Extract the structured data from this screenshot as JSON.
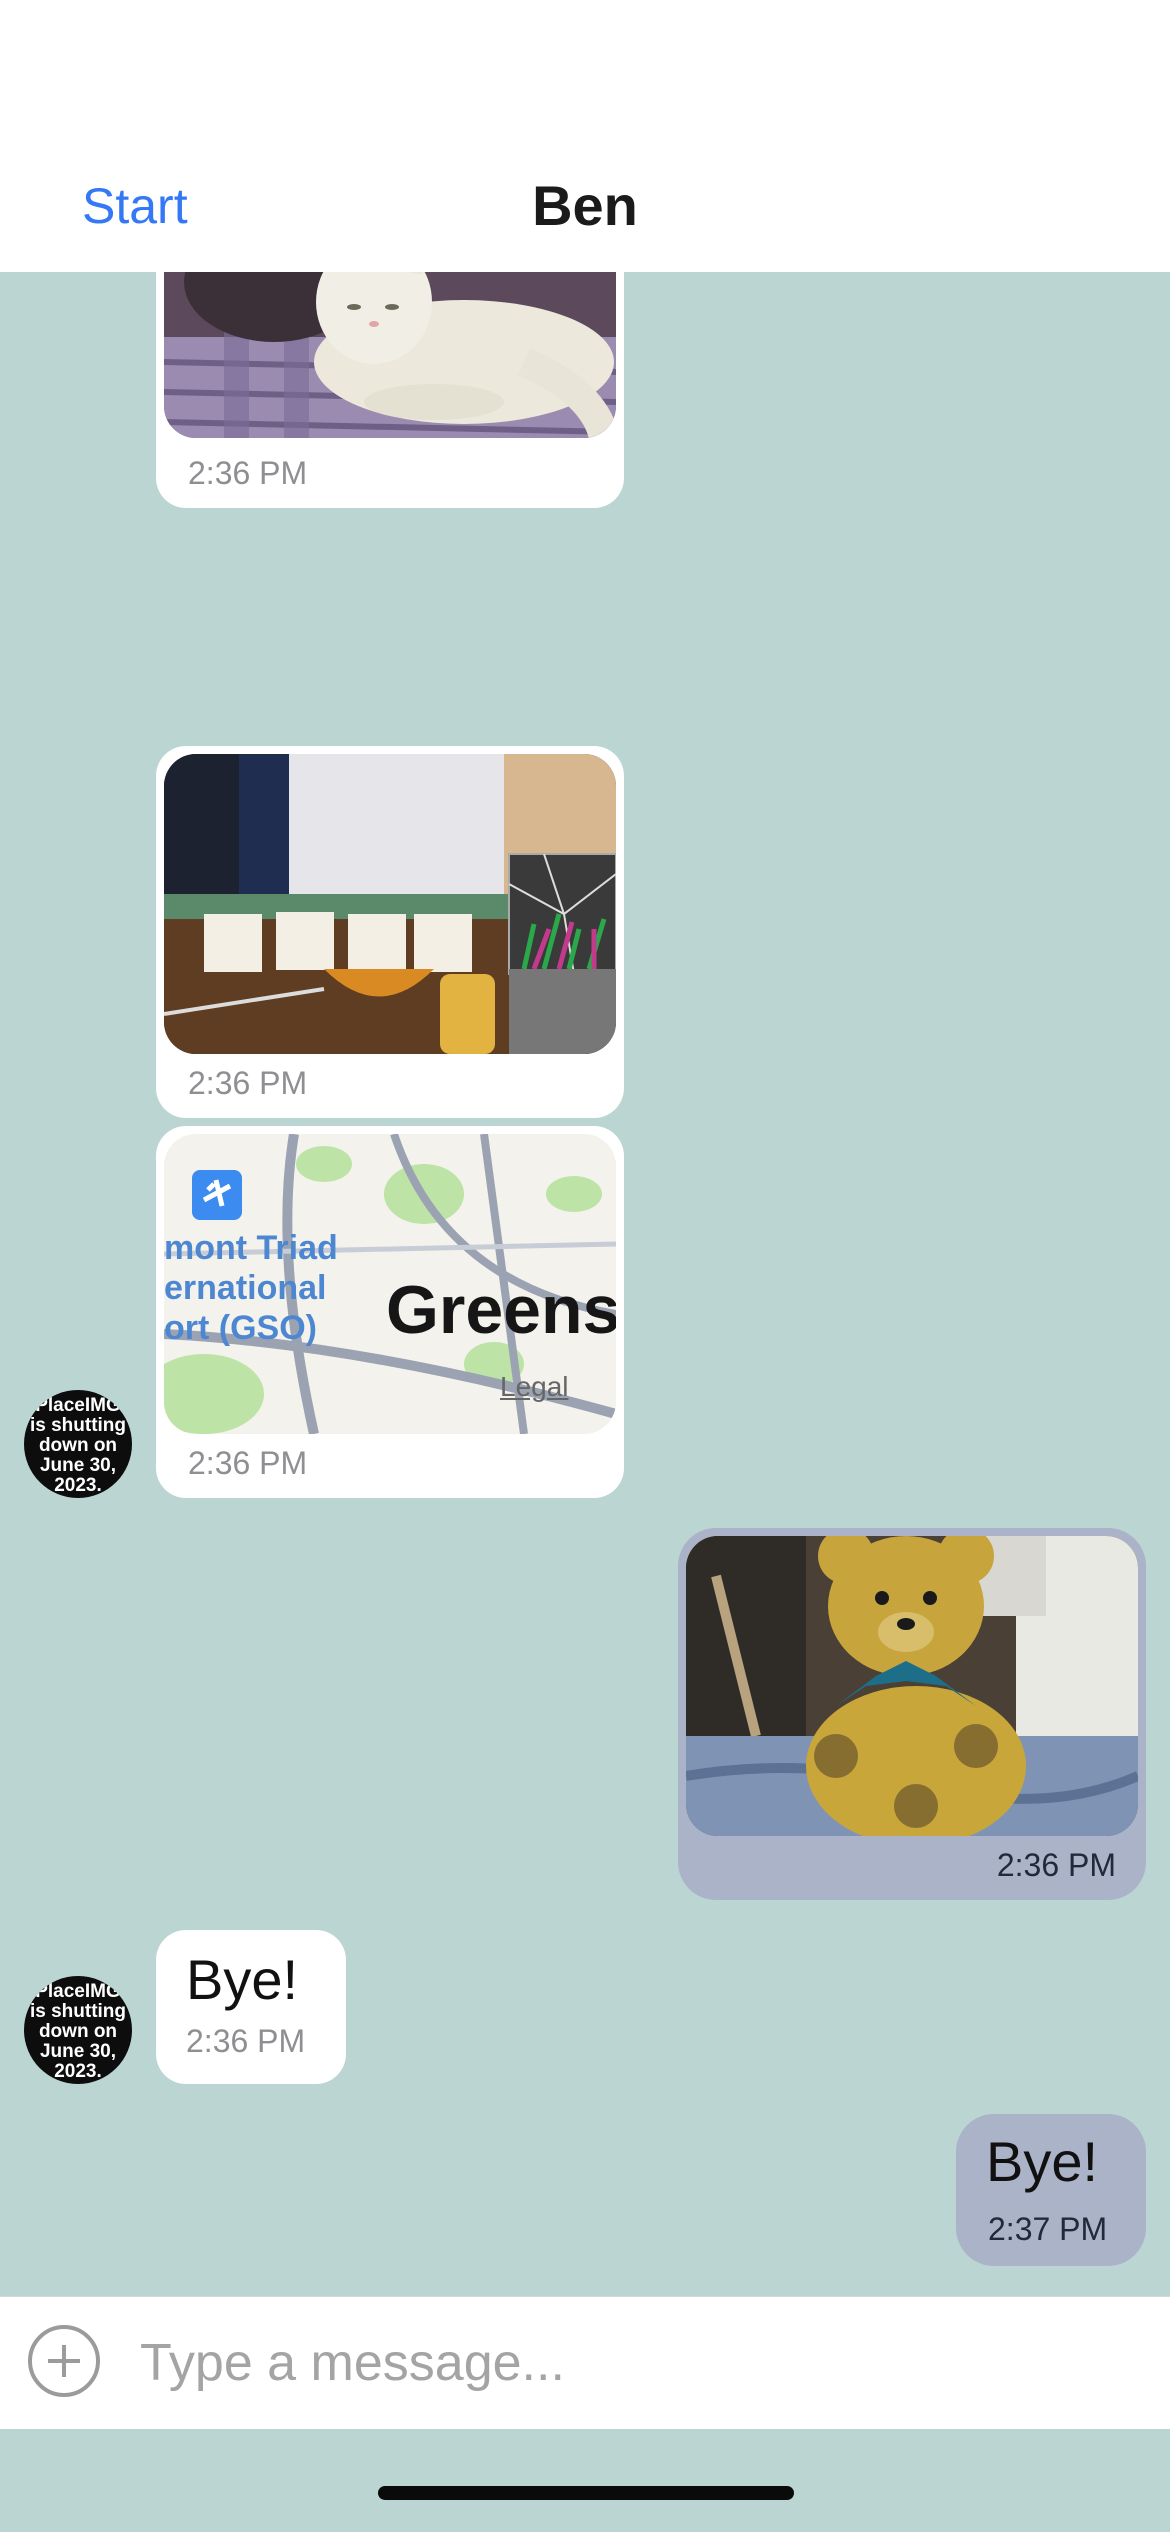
{
  "header": {
    "back_label": "Start",
    "title": "Ben"
  },
  "messages": [
    {
      "from": "Ben",
      "type": "image",
      "subject": "white cat lying on a purple blanket",
      "time": "2:36 PM"
    },
    {
      "from": "Ben",
      "type": "image",
      "subject": "desk with monitor, notes, bowl, candle and pen holder",
      "time": "2:36 PM"
    },
    {
      "from": "Ben",
      "type": "map",
      "map_labels": [
        "mont Triad",
        "ernational",
        "ort (GSO)",
        "Greens"
      ],
      "legal_label": "Legal",
      "time": "2:36 PM"
    },
    {
      "from": "me",
      "type": "image",
      "subject": "teddy bear with sunflower pattern and blue bow",
      "time": "2:36 PM"
    },
    {
      "from": "Ben",
      "type": "text",
      "text": "Bye!",
      "time": "2:36 PM"
    },
    {
      "from": "me",
      "type": "text",
      "text": "Bye!",
      "time": "2:37 PM"
    }
  ],
  "avatar_text": [
    "PlaceIMG",
    "is shutting",
    "down on",
    "June 30,",
    "2023."
  ],
  "composer": {
    "placeholder": "Type a message..."
  },
  "colors": {
    "chat_background": "#bad5d2",
    "incoming_bubble": "#ffffff",
    "outgoing_bubble": "#aab3c7",
    "accent": "#3478f6"
  }
}
